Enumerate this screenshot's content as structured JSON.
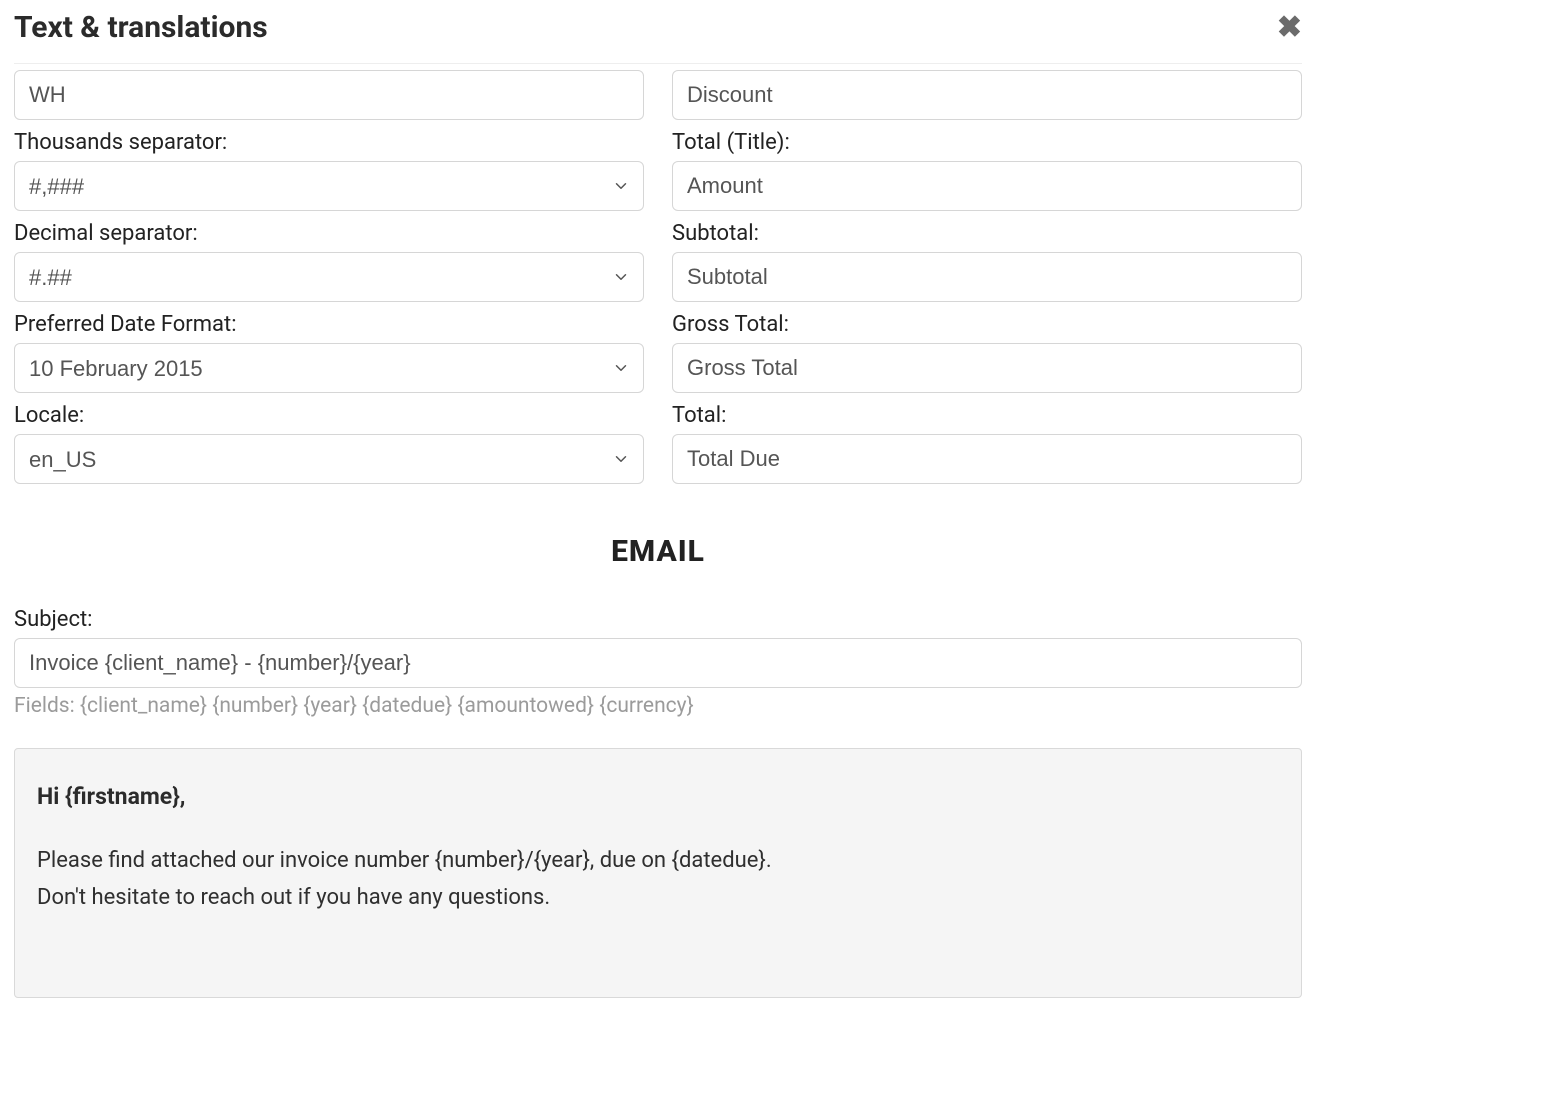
{
  "modal": {
    "title": "Text & translations"
  },
  "left": {
    "wh_value": "WH",
    "thousands_label": "Thousands separator:",
    "thousands_value": "#,###",
    "decimal_label": "Decimal separator:",
    "decimal_value": "#.##",
    "date_format_label": "Preferred Date Format:",
    "date_format_value": "10 February 2015",
    "locale_label": "Locale:",
    "locale_value": "en_US"
  },
  "right": {
    "discount_value": "Discount",
    "total_title_label": "Total (Title):",
    "total_title_value": "Amount",
    "subtotal_label": "Subtotal:",
    "subtotal_value": "Subtotal",
    "gross_total_label": "Gross Total:",
    "gross_total_value": "Gross Total",
    "total_label": "Total:",
    "total_value": "Total Due"
  },
  "email": {
    "heading": "EMAIL",
    "subject_label": "Subject:",
    "subject_value": "Invoice {client_name} - {number}/{year}",
    "hint": "Fields: {client_name} {number} {year} {datedue} {amountowed} {currency}",
    "body_greeting": "Hi {firstname},",
    "body_line1": "Please find attached our invoice number {number}/{year}, due on {datedue}.",
    "body_line2": "Don't hesitate to reach out if you have any questions."
  }
}
